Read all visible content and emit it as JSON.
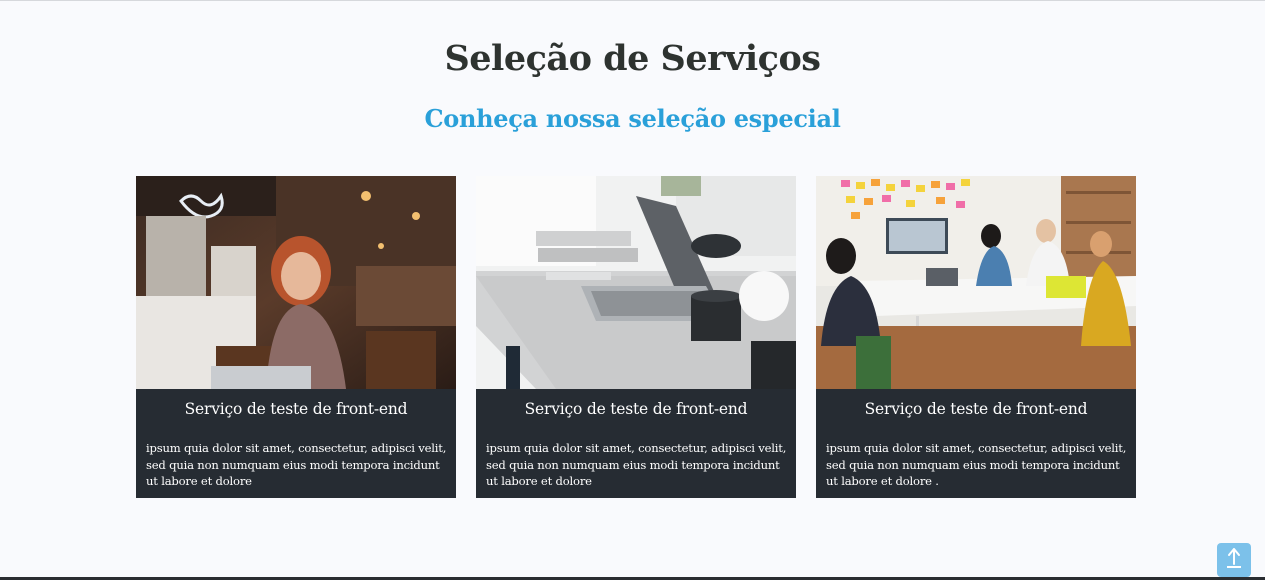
{
  "section": {
    "title": "Seleção de Serviços",
    "subtitle": "Conheça nossa seleção especial"
  },
  "cards": [
    {
      "title": "Serviço de teste de front-end",
      "text": "ipsum quia dolor sit amet, consectetur, adipisci velit, sed quia non numquam eius modi tempora incidunt ut labore et dolore",
      "image": "woman-with-laptop-in-cafe"
    },
    {
      "title": "Serviço de teste de front-end",
      "text": "ipsum quia dolor sit amet, consectetur, adipisci velit, sed quia non numquam eius modi tempora incidunt ut labore et dolore",
      "image": "laptop-on-desk"
    },
    {
      "title": "Serviço de teste de front-end",
      "text": "ipsum quia dolor sit amet, consectetur, adipisci velit, sed quia non numquam eius modi tempora incidunt ut labore et dolore .",
      "image": "team-meeting-office"
    }
  ],
  "scroll_top": {
    "icon": "arrow-up-icon"
  },
  "colors": {
    "background": "#f9fafd",
    "title": "#2e3330",
    "subtitle": "#2aa0d9",
    "card": "#262c33",
    "scroll_button": "#7cc1ea"
  }
}
